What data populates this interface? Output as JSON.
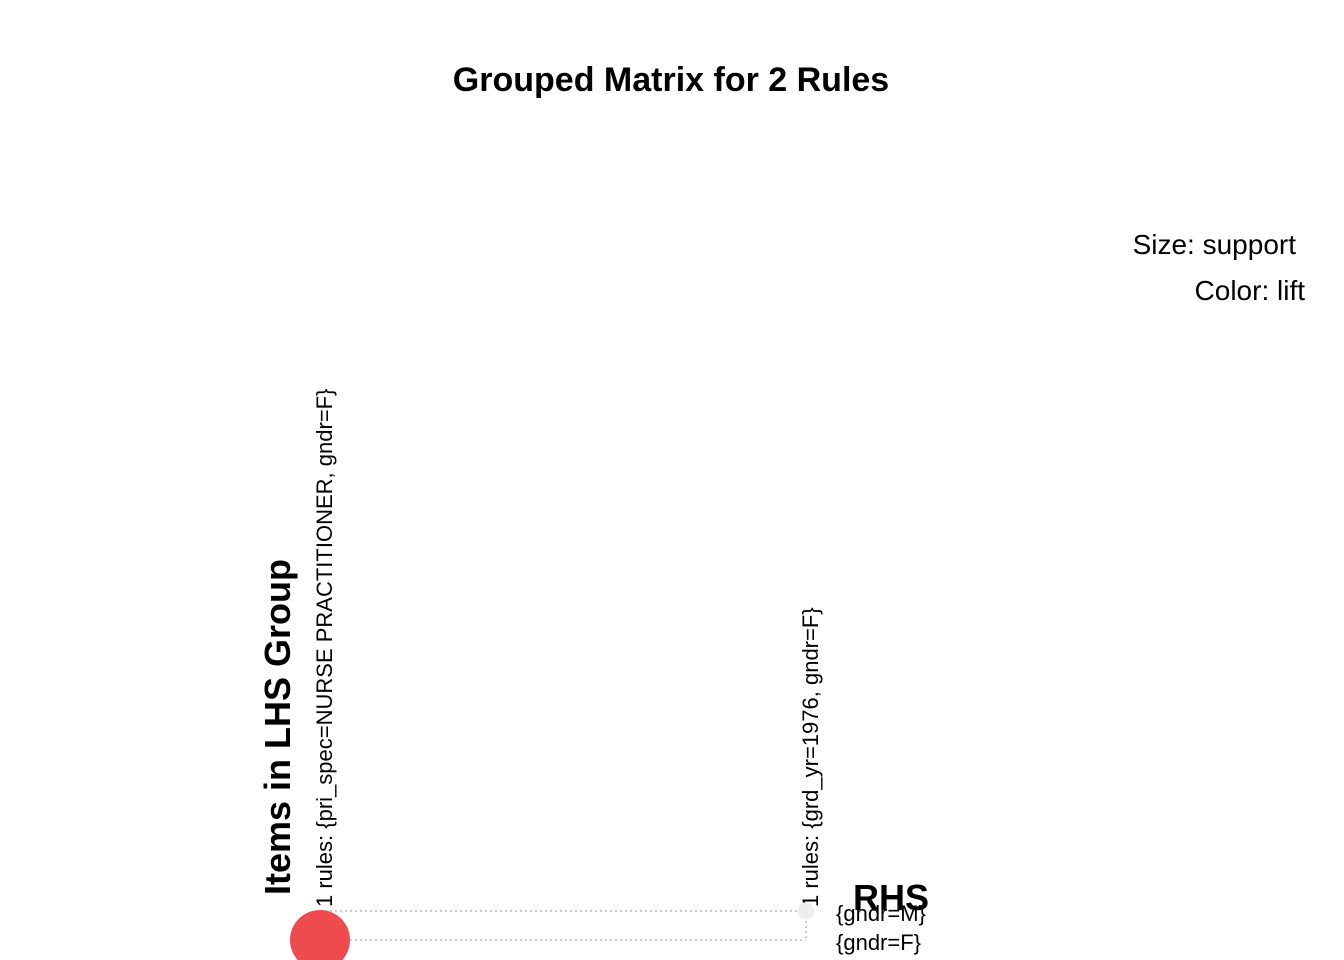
{
  "chart_data": {
    "type": "grouped-matrix",
    "title": "Grouped Matrix for 2 Rules",
    "xlabel": "Items in LHS Group",
    "ylabel": "RHS",
    "legend": {
      "size_label": "Size: support",
      "color_label": "Color: lift",
      "placement": "top-right"
    },
    "lhs_groups": [
      "1 rules: {pri_spec=NURSE PRACTITIONER, gndr=F}",
      "1 rules: {grd_yr=1976, gndr=F}"
    ],
    "rhs_items": [
      "{gndr=M}",
      "{gndr=F}"
    ],
    "points": [
      {
        "lhs_group": "1 rules: {pri_spec=NURSE PRACTITIONER, gndr=F}",
        "rhs": "{gndr=F}",
        "support": 1.0,
        "lift": 1.0,
        "color": "#ee4b4f"
      },
      {
        "lhs_group": "1 rules: {grd_yr=1976, gndr=F}",
        "rhs": "{gndr=M}",
        "support": 0.02,
        "lift": 0.0,
        "color": "#eeeeee"
      }
    ],
    "grid": true
  }
}
